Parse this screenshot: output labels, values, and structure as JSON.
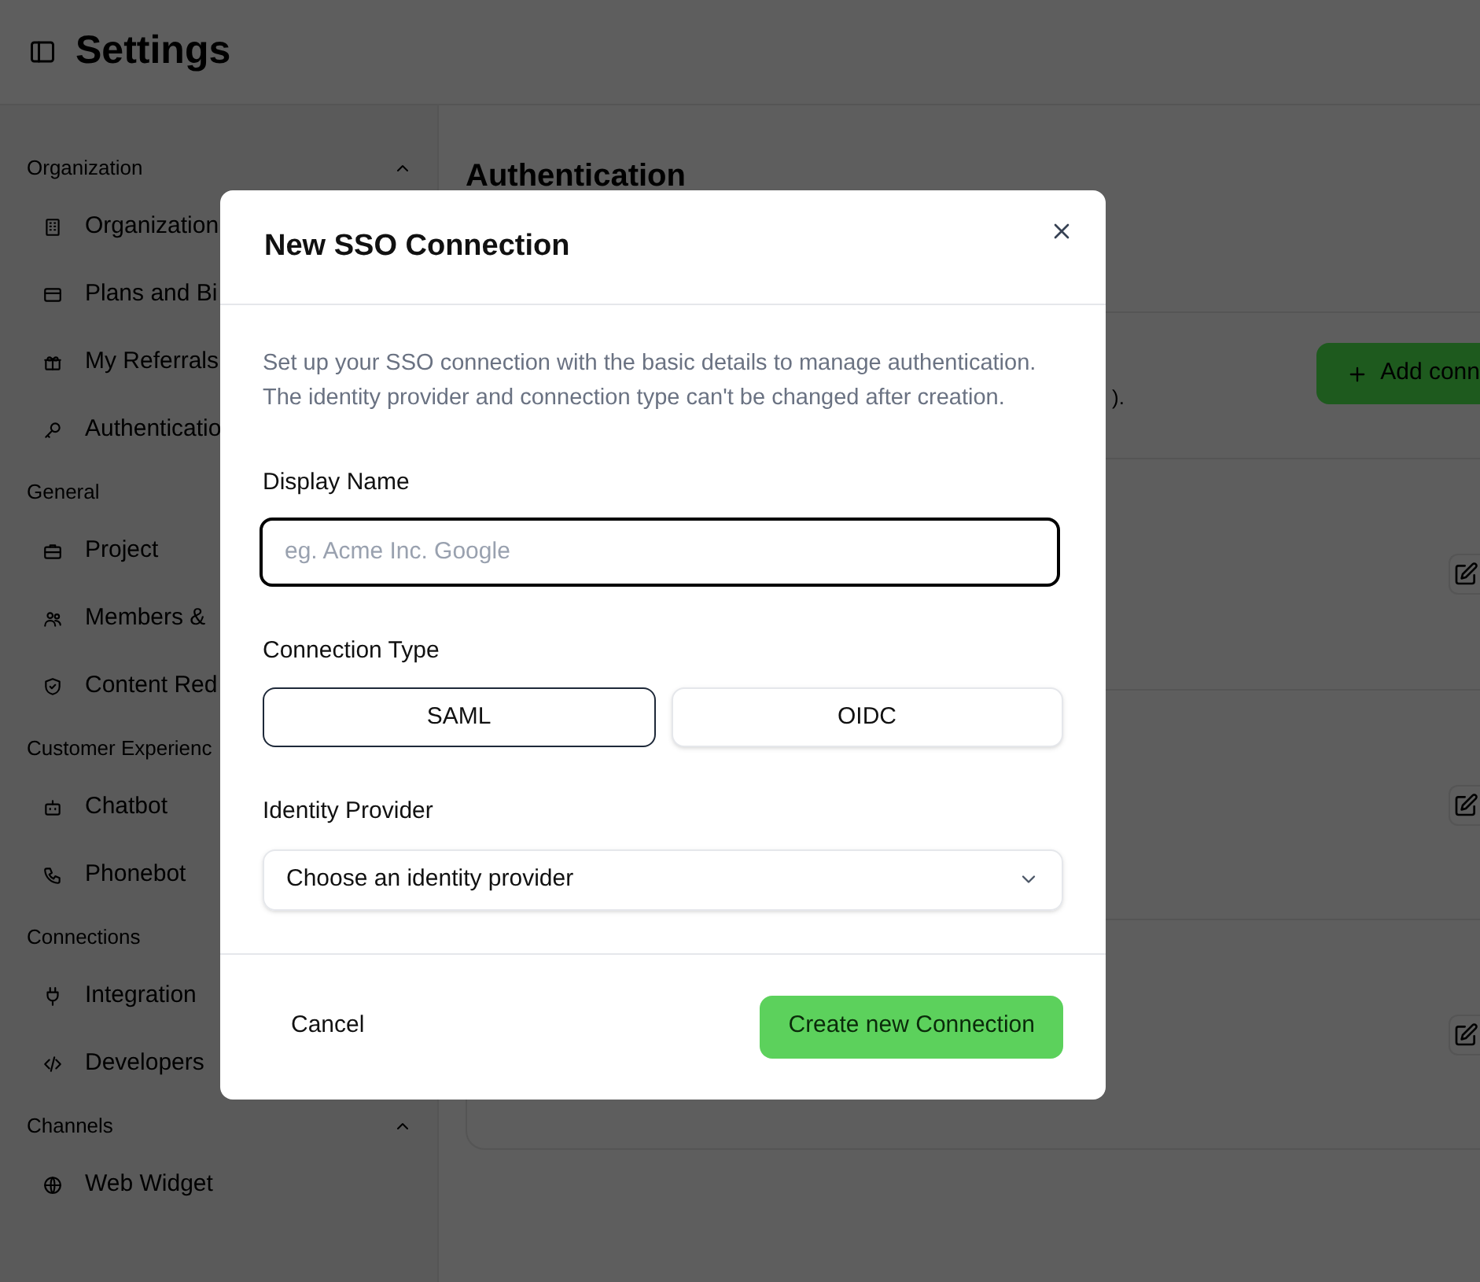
{
  "header": {
    "title": "Settings"
  },
  "sidebar": {
    "sections": [
      {
        "label": "Organization",
        "collapsible": true,
        "items": [
          {
            "label": "Organization"
          },
          {
            "label": "Plans and Bi"
          },
          {
            "label": "My Referrals"
          },
          {
            "label": "Authenticatio"
          }
        ]
      },
      {
        "label": "General",
        "items": [
          {
            "label": "Project"
          },
          {
            "label": "Members &"
          },
          {
            "label": "Content Red"
          }
        ]
      },
      {
        "label": "Customer Experienc",
        "items": [
          {
            "label": "Chatbot"
          },
          {
            "label": "Phonebot"
          }
        ]
      },
      {
        "label": "Connections",
        "items": [
          {
            "label": "Integration"
          },
          {
            "label": "Developers"
          }
        ]
      },
      {
        "label": "Channels",
        "collapsible": true,
        "items": [
          {
            "label": "Web Widget"
          }
        ]
      }
    ]
  },
  "main": {
    "title": "Authentication",
    "fragment": ").",
    "add_button": {
      "label": "Add conn"
    },
    "connection_rows": [
      {
        "kind": "edit"
      },
      {
        "kind": "edit"
      },
      {
        "kind": "edit"
      }
    ]
  },
  "modal": {
    "title": "New SSO Connection",
    "description": "Set up your SSO connection with the basic details to manage authentication. The identity provider and connection type can't be changed after creation.",
    "display_name": {
      "label": "Display Name",
      "placeholder": "eg. Acme Inc. Google",
      "focused": true
    },
    "connection_type": {
      "label": "Connection Type",
      "options": [
        {
          "label": "SAML",
          "selected": true
        },
        {
          "label": "OIDC",
          "selected": false
        }
      ]
    },
    "identity_provider": {
      "label": "Identity Provider",
      "value": "Choose an identity provider"
    },
    "buttons": [
      {
        "kind": "cancel",
        "label": "Cancel"
      },
      {
        "kind": "primary",
        "label": "Create new Connection"
      }
    ]
  }
}
